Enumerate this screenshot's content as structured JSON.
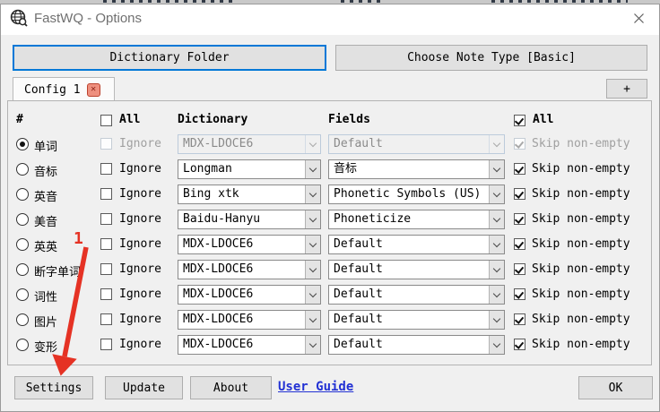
{
  "window": {
    "title": "FastWQ - Options",
    "close_glyph": "✕"
  },
  "toolbar": {
    "dictionary_folder_label": "Dictionary Folder",
    "choose_note_type_label": "Choose Note Type [Basic]"
  },
  "tabs": {
    "active_tab_label": "Config 1",
    "tab_close_glyph": "✕",
    "add_tab_label": "+"
  },
  "table": {
    "headers": {
      "number": "#",
      "all_left": "All",
      "dictionary": "Dictionary",
      "fields": "Fields",
      "all_right": "All"
    },
    "all_left_checked": false,
    "all_right_checked": true,
    "ignore_label": "Ignore",
    "skip_label": "Skip non-empty",
    "rows": [
      {
        "label": "单词",
        "selected": true,
        "disabled": true,
        "ignore": false,
        "dictionary": "MDX-LDOCE6",
        "field": "Default",
        "skip": true
      },
      {
        "label": "音标",
        "selected": false,
        "disabled": false,
        "ignore": false,
        "dictionary": "Longman",
        "field": "音标",
        "skip": true
      },
      {
        "label": "英音",
        "selected": false,
        "disabled": false,
        "ignore": false,
        "dictionary": "Bing xtk",
        "field": "Phonetic Symbols (US)",
        "skip": true
      },
      {
        "label": "美音",
        "selected": false,
        "disabled": false,
        "ignore": false,
        "dictionary": "Baidu-Hanyu",
        "field": "Phoneticize",
        "skip": true
      },
      {
        "label": "英英",
        "selected": false,
        "disabled": false,
        "ignore": false,
        "dictionary": "MDX-LDOCE6",
        "field": "Default",
        "skip": true
      },
      {
        "label": "断字单词",
        "selected": false,
        "disabled": false,
        "ignore": false,
        "dictionary": "MDX-LDOCE6",
        "field": "Default",
        "skip": true
      },
      {
        "label": "词性",
        "selected": false,
        "disabled": false,
        "ignore": false,
        "dictionary": "MDX-LDOCE6",
        "field": "Default",
        "skip": true
      },
      {
        "label": "图片",
        "selected": false,
        "disabled": false,
        "ignore": false,
        "dictionary": "MDX-LDOCE6",
        "field": "Default",
        "skip": true
      },
      {
        "label": "变形",
        "selected": false,
        "disabled": false,
        "ignore": false,
        "dictionary": "MDX-LDOCE6",
        "field": "Default",
        "skip": true
      }
    ]
  },
  "footer": {
    "settings_label": "Settings",
    "update_label": "Update",
    "about_label": "About",
    "user_guide_label": "User Guide",
    "ok_label": "OK"
  },
  "annotation": {
    "step_number": "1",
    "color": "#e53224"
  },
  "colors": {
    "accent_focus": "#0078d7",
    "link": "#2231d4",
    "tab_close_bg": "#ee8f7e"
  }
}
